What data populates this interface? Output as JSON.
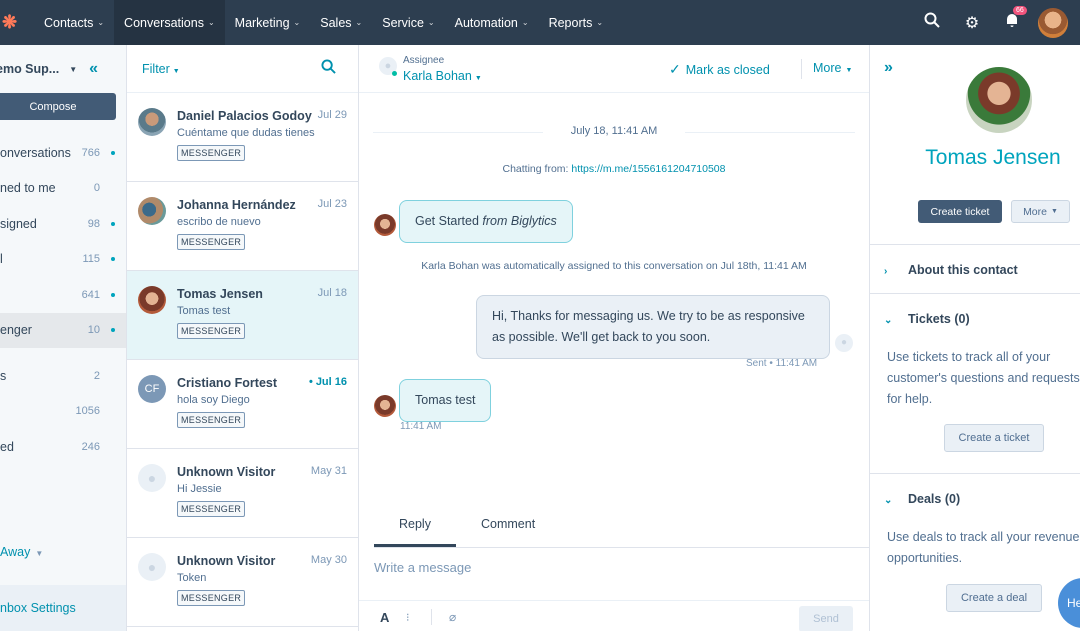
{
  "nav": {
    "logo_icon": "hubspot-sprocket-icon",
    "items": [
      {
        "label": "Contacts"
      },
      {
        "label": "Conversations"
      },
      {
        "label": "Marketing"
      },
      {
        "label": "Sales"
      },
      {
        "label": "Service"
      },
      {
        "label": "Automation"
      },
      {
        "label": "Reports"
      }
    ],
    "notification_count": "66"
  },
  "sidebar": {
    "inbox_name": "emo Sup...",
    "compose_label": "Compose",
    "items": [
      {
        "label": "onversations",
        "count": "766"
      },
      {
        "label": "ned to me",
        "count": "0"
      },
      {
        "label": "signed",
        "count": "98"
      },
      {
        "label": "l",
        "count": "115"
      },
      {
        "label": "",
        "count": "641"
      },
      {
        "label": "enger",
        "count": "10"
      },
      {
        "label": "s",
        "count": "2"
      },
      {
        "label": "",
        "count": "1056"
      },
      {
        "label": "ed",
        "count": "246"
      }
    ],
    "away_label": "Away",
    "settings_label": "nbox Settings"
  },
  "convlist": {
    "filter_label": "Filter",
    "items": [
      {
        "name": "Daniel Palacios Godoy",
        "date": "Jul 29",
        "preview": "Cuéntame que dudas tienes",
        "tag": "MESSENGER"
      },
      {
        "name": "Johanna Hernández",
        "date": "Jul 23",
        "preview": "escribo de nuevo",
        "tag": "MESSENGER"
      },
      {
        "name": "Tomas Jensen",
        "date": "Jul 18",
        "preview": "Tomas test",
        "tag": "MESSENGER"
      },
      {
        "name": "Cristiano Fortest",
        "date": "Jul 16",
        "preview": "hola soy Diego",
        "tag": "MESSENGER",
        "initials": "CF"
      },
      {
        "name": "Unknown Visitor",
        "date": "May 31",
        "preview": "Hi Jessie",
        "tag": "MESSENGER"
      },
      {
        "name": "Unknown Visitor",
        "date": "May 30",
        "preview": "Token",
        "tag": "MESSENGER"
      }
    ]
  },
  "chat": {
    "assignee_label": "Assignee",
    "assignee_name": "Karla Bohan",
    "mark_closed_label": "Mark as closed",
    "more_label": "More",
    "date_divider": "July 18, 11:41 AM",
    "chatting_from_prefix": "Chatting from:",
    "chatting_from_link": "https://m.me/1556161204710508",
    "msg1_text": "Get Started",
    "msg1_suffix": "from Biglytics",
    "system_msg": "Karla Bohan was automatically assigned to this conversation on Jul 18th, 11:41 AM",
    "msg2_line1": "Hi, Thanks for messaging us. We try to be as responsive",
    "msg2_line2": "as possible. We'll get back to you soon.",
    "msg2_meta": "Sent • 11:41 AM",
    "msg3_text": "Tomas test",
    "msg3_meta": "11:41 AM",
    "tab_reply": "Reply",
    "tab_comment": "Comment",
    "composer_placeholder": "Write a message",
    "send_label": "Send"
  },
  "contact": {
    "name": "Tomas Jensen",
    "create_ticket_label": "Create ticket",
    "more_label": "More",
    "about_label": "About this contact",
    "tickets_label": "Tickets (0)",
    "tickets_text": "Use tickets to track all of your customer's questions and requests for help.",
    "create_a_ticket_label": "Create a ticket",
    "deals_label": "Deals (0)",
    "deals_text": "Use deals to track all your revenue opportunities.",
    "create_a_deal_label": "Create a deal",
    "chat_fab_label": "He"
  }
}
